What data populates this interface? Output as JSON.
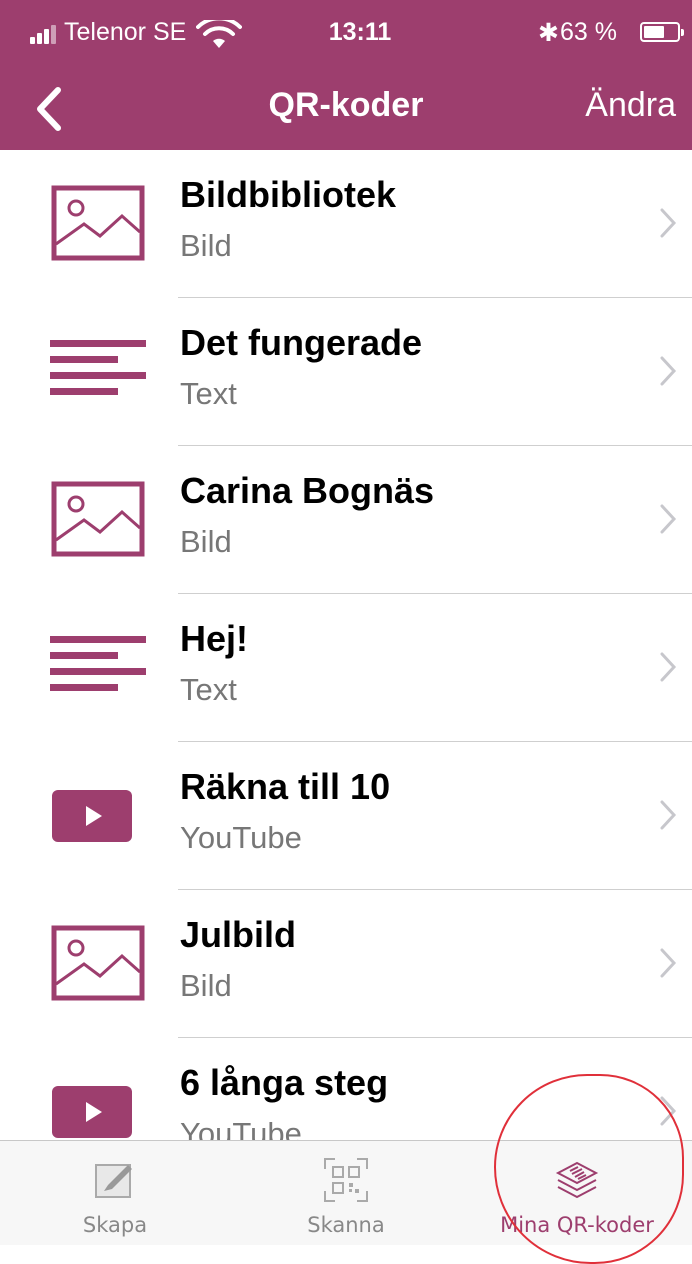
{
  "status_bar": {
    "carrier": "Telenor SE",
    "time": "13:11",
    "battery": "63 %",
    "battery_level": 0.63
  },
  "nav": {
    "title": "QR-koder",
    "edit_label": "Ändra"
  },
  "items": [
    {
      "title": "Bildbibliotek",
      "subtitle": "Bild",
      "icon": "image-icon"
    },
    {
      "title": "Det fungerade",
      "subtitle": "Text",
      "icon": "text-icon"
    },
    {
      "title": "Carina Bognäs",
      "subtitle": "Bild",
      "icon": "image-icon"
    },
    {
      "title": "Hej!",
      "subtitle": "Text",
      "icon": "text-icon"
    },
    {
      "title": "Räkna till 10",
      "subtitle": "YouTube",
      "icon": "youtube-icon"
    },
    {
      "title": "Julbild",
      "subtitle": "Bild",
      "icon": "image-icon"
    },
    {
      "title": "6 långa steg",
      "subtitle": "YouTube",
      "icon": "youtube-icon"
    }
  ],
  "tabs": [
    {
      "label": "Skapa",
      "icon": "create-icon"
    },
    {
      "label": "Skanna",
      "icon": "scan-qr-icon"
    },
    {
      "label": "Mina QR-koder",
      "icon": "layers-icon"
    }
  ],
  "colors": {
    "accent": "#9d3e6e",
    "annotation": "#e0303a"
  }
}
